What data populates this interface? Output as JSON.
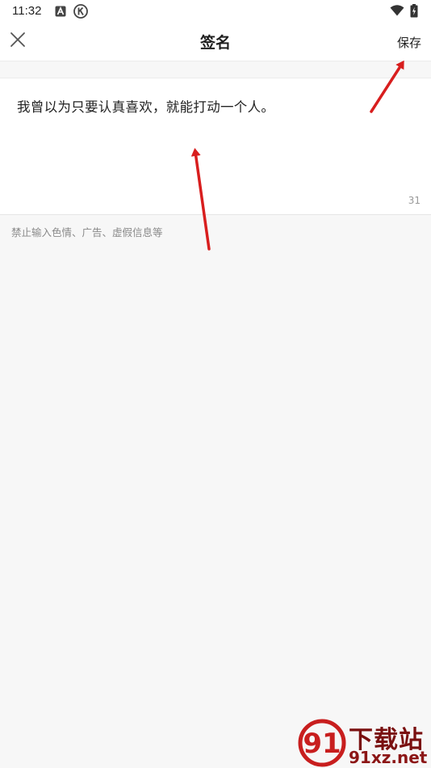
{
  "status_bar": {
    "time": "11:32",
    "icons": [
      "a-notification-icon",
      "k-notification-icon",
      "wifi-icon",
      "battery-charging-icon"
    ]
  },
  "header": {
    "title": "签名",
    "save_label": "保存",
    "close_icon": "close-icon"
  },
  "editor": {
    "text": "我曾以为只要认真喜欢，就能打动一个人。",
    "char_count": "31"
  },
  "hint": "禁止输入色情、广告、虚假信息等",
  "annotations": {
    "arrow_color": "#d81e1e"
  },
  "watermark": {
    "title": "下载站",
    "domain": "91xz.net",
    "logo_text": "91",
    "color": "#7a1010"
  }
}
